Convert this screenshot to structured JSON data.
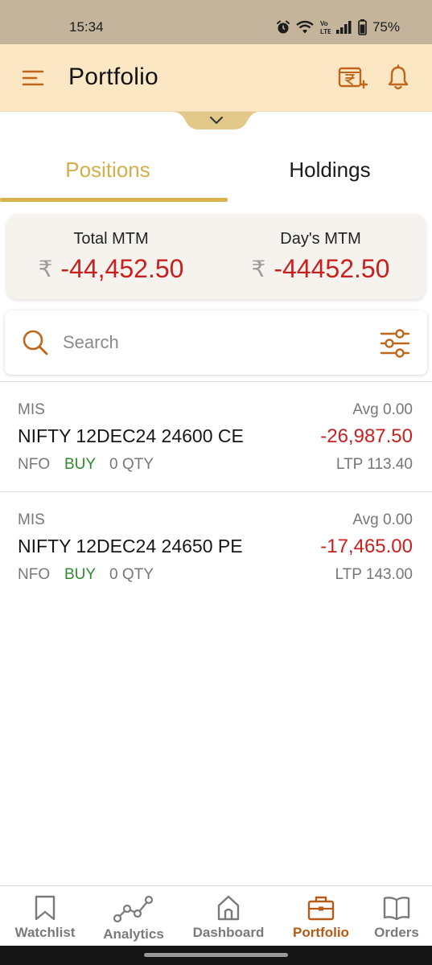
{
  "status_bar": {
    "time": "15:34",
    "battery": "75%"
  },
  "header": {
    "title": "Portfolio"
  },
  "tabs": [
    {
      "label": "Positions",
      "active": true
    },
    {
      "label": "Holdings",
      "active": false
    }
  ],
  "mtm": {
    "currency_symbol": "₹",
    "total_label": "Total MTM",
    "total_value": "-44,452.50",
    "day_label": "Day's MTM",
    "day_value": "-44452.50"
  },
  "search": {
    "placeholder": "Search"
  },
  "positions": [
    {
      "product": "MIS",
      "avg": "Avg  0.00",
      "symbol": "NIFTY 12DEC24 24600 CE",
      "pnl": "-26,987.50",
      "exchange": "NFO",
      "side": "BUY",
      "qty": "0  QTY",
      "ltp": "LTP 113.40"
    },
    {
      "product": "MIS",
      "avg": "Avg  0.00",
      "symbol": "NIFTY 12DEC24 24650 PE",
      "pnl": "-17,465.00",
      "exchange": "NFO",
      "side": "BUY",
      "qty": "0  QTY",
      "ltp": "LTP 143.00"
    }
  ],
  "bottom_nav": [
    {
      "label": "Watchlist",
      "icon": "bookmark-icon",
      "active": false
    },
    {
      "label": "Analytics",
      "icon": "line-graph-icon",
      "active": false
    },
    {
      "label": "Dashboard",
      "icon": "home-icon",
      "active": false
    },
    {
      "label": "Portfolio",
      "icon": "briefcase-icon",
      "active": true
    },
    {
      "label": "Orders",
      "icon": "book-icon",
      "active": false
    }
  ],
  "colors": {
    "accent_gold": "#d7b24d",
    "header_bg": "#fbe7c4",
    "icon_orange": "#c0661c",
    "loss_red": "#c8201f",
    "buy_green": "#2e8b2e",
    "active_nav": "#b75a14"
  }
}
